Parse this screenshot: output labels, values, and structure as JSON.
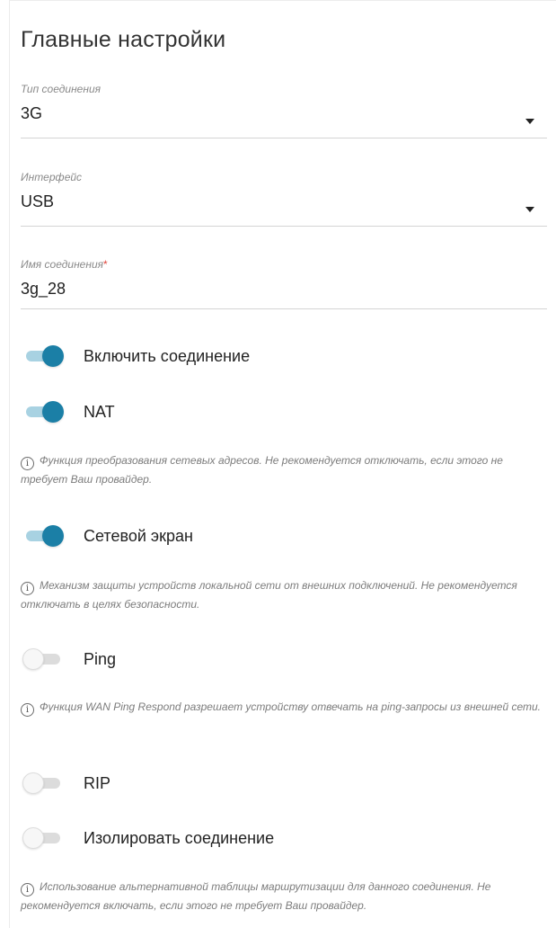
{
  "title": "Главные настройки",
  "fields": {
    "connection_type": {
      "label": "Тип соединения",
      "value": "3G"
    },
    "interface": {
      "label": "Интерфейс",
      "value": "USB"
    },
    "connection_name": {
      "label": "Имя соединения",
      "required_mark": "*",
      "value": "3g_28"
    }
  },
  "toggles": {
    "enable": {
      "label": "Включить соединение",
      "on": true
    },
    "nat": {
      "label": "NAT",
      "on": true,
      "hint": "Функция преобразования сетевых адресов. Не рекомендуется отключать, если этого не требует Ваш провайдер."
    },
    "firewall": {
      "label": "Сетевой экран",
      "on": true,
      "hint": "Механизм защиты устройств локальной сети от внешних подключений. Не рекомендуется отключать в целях безопасности."
    },
    "ping": {
      "label": "Ping",
      "on": false,
      "hint": "Функция WAN Ping Respond разрешает устройству отвечать на ping-запросы из внешней сети."
    },
    "rip": {
      "label": "RIP",
      "on": false
    },
    "isolate": {
      "label": "Изолировать соединение",
      "on": false,
      "hint": "Использование альтернативной таблицы маршрутизации для данного соединения. Не рекомендуется включать, если этого не требует Ваш провайдер."
    }
  },
  "icons": {
    "dropdown": "caret-down-icon",
    "info": "info-circle-icon"
  },
  "colors": {
    "accent": "#1b7fa6",
    "track_on": "#a8d2e2",
    "track_off": "#dcdcdc"
  }
}
